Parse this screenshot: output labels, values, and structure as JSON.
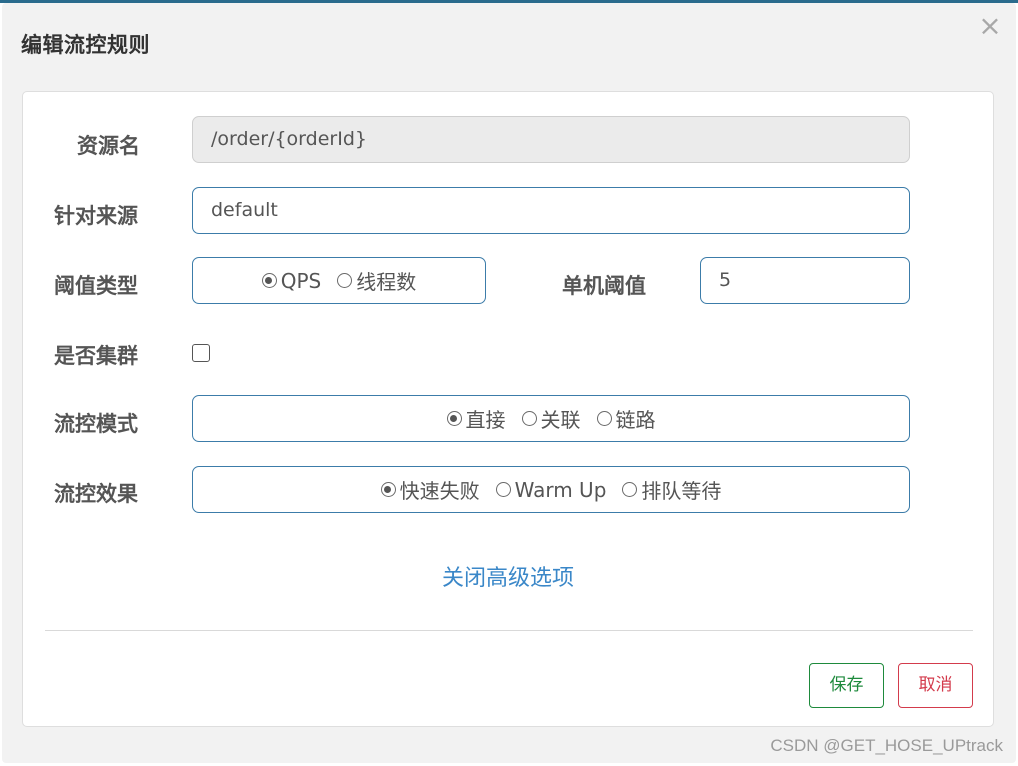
{
  "dialog": {
    "title": "编辑流控规则",
    "close_label": "×"
  },
  "form": {
    "resource_name": {
      "label": "资源名",
      "value": "/order/{orderId}"
    },
    "limit_app": {
      "label": "针对来源",
      "value": "default"
    },
    "threshold_type": {
      "label": "阈值类型",
      "options": [
        {
          "label": "QPS",
          "checked": true
        },
        {
          "label": "线程数",
          "checked": false
        }
      ]
    },
    "single_threshold": {
      "label": "单机阈值",
      "value": "5"
    },
    "cluster": {
      "label": "是否集群",
      "checked": false
    },
    "control_mode": {
      "label": "流控模式",
      "options": [
        {
          "label": "直接",
          "checked": true
        },
        {
          "label": "关联",
          "checked": false
        },
        {
          "label": "链路",
          "checked": false
        }
      ]
    },
    "control_effect": {
      "label": "流控效果",
      "options": [
        {
          "label": "快速失败",
          "checked": true
        },
        {
          "label": "Warm Up",
          "checked": false
        },
        {
          "label": "排队等待",
          "checked": false
        }
      ]
    },
    "advanced_link": "关闭高级选项"
  },
  "footer": {
    "save_label": "保存",
    "cancel_label": "取消"
  },
  "watermark": "CSDN @GET_HOSE_UPtrack",
  "colors": {
    "accent": "#3c7ca9",
    "link": "#3a87c8",
    "save": "#1e8a3c",
    "cancel": "#d33b4c"
  }
}
